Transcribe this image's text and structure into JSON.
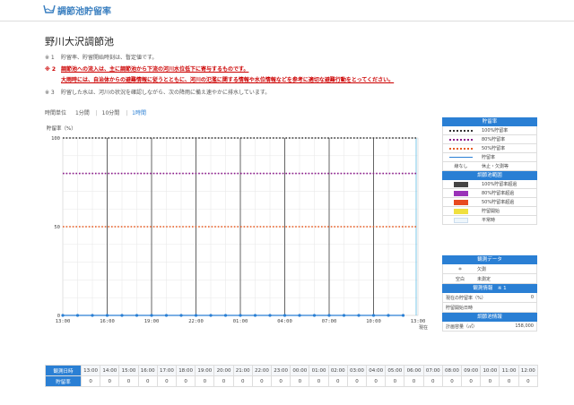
{
  "header": {
    "title": "調節池貯留率"
  },
  "site": {
    "name": "野川大沢調節池"
  },
  "notes": [
    {
      "marker": "※ 1",
      "text": "貯留率、貯留開始時刻は、暫定値です。"
    },
    {
      "marker": "※ 2",
      "line1": "調節池への流入は、主に調節池から下流の河川水位低下に寄与するものです。",
      "line2": "大雨時には、自治体からの避難情報に従うとともに、河川の氾濫に関する情報や水位情報などを参考に適切な避難行動をとってください。"
    },
    {
      "marker": "※ 3",
      "text": "貯留した水は、河川の状況を確認しながら、次の降雨に備え速やかに排水しています。"
    }
  ],
  "time_unit": {
    "label": "時間単位",
    "options": [
      "1分間",
      "10分間",
      "1時間"
    ],
    "active": "1時間"
  },
  "chart_data": {
    "type": "line",
    "ylabel": "貯留率（%）",
    "ylim": [
      0,
      100
    ],
    "yticks": [
      "0",
      "50",
      "100"
    ],
    "x_ticks": [
      "13:00",
      "16:00",
      "19:00",
      "22:00",
      "01:00",
      "04:00",
      "07:00",
      "10:00",
      "13:00"
    ],
    "now_label": "現在",
    "reference_lines": [
      {
        "level": 100,
        "color": "#333333"
      },
      {
        "level": 80,
        "color": "#8b1a8b"
      },
      {
        "level": 50,
        "color": "#e85a20"
      }
    ],
    "series": [
      {
        "x": [
          "13:00",
          "14:00",
          "15:00",
          "16:00",
          "17:00",
          "18:00",
          "19:00",
          "20:00",
          "21:00",
          "22:00",
          "23:00",
          "00:00",
          "01:00",
          "02:00",
          "03:00",
          "04:00",
          "05:00",
          "06:00",
          "07:00",
          "08:00",
          "09:00",
          "10:00",
          "11:00",
          "12:00"
        ],
        "values": [
          0,
          0,
          0,
          0,
          0,
          0,
          0,
          0,
          0,
          0,
          0,
          0,
          0,
          0,
          0,
          0,
          0,
          0,
          0,
          0,
          0,
          0,
          0,
          0
        ],
        "color": "#2a7fd4"
      }
    ]
  },
  "legend": {
    "title": "貯留率",
    "items": [
      {
        "label": "100%貯留率",
        "color": "#333333",
        "kind": "dot"
      },
      {
        "label": "80%貯留率",
        "color": "#8b1a8b",
        "kind": "dot"
      },
      {
        "label": "50%貯留率",
        "color": "#e85a20",
        "kind": "dot"
      },
      {
        "label": "貯留率",
        "color": "#2a7fd4",
        "kind": "solid"
      },
      {
        "sym": "線なし",
        "label": "休止・欠測等",
        "kind": "text"
      }
    ],
    "bg_title": "調節池範囲",
    "bg_items": [
      {
        "label": "100%貯留率超過",
        "color": "#444444"
      },
      {
        "label": "80%貯留率超過",
        "color": "#9a32b8"
      },
      {
        "label": "50%貯留率超過",
        "color": "#e84a20"
      },
      {
        "label": "貯留開始",
        "color": "#f0e040"
      },
      {
        "label": "平常時",
        "color": "#eef6fb"
      }
    ]
  },
  "data_legend": {
    "title": "観測データ",
    "items": [
      {
        "sym": "＊",
        "label": "欠測"
      },
      {
        "sym": "空白",
        "label": "未測定"
      }
    ],
    "info_title": "観測情報　※ 1",
    "info": [
      {
        "label": "現在の貯留率（%）",
        "value": "0"
      },
      {
        "label": "貯留開始日時",
        "value": ""
      }
    ],
    "facility_title": "調節池情報",
    "facility": [
      {
        "label": "計画容量（㎥）",
        "value": "158,000"
      }
    ]
  },
  "table": {
    "row_labels": [
      "観測日時",
      "貯留率"
    ],
    "times": [
      "13:00",
      "14:00",
      "15:00",
      "16:00",
      "17:00",
      "18:00",
      "19:00",
      "20:00",
      "21:00",
      "22:00",
      "23:00",
      "00:00",
      "01:00",
      "02:00",
      "03:00",
      "04:00",
      "05:00",
      "06:00",
      "07:00",
      "08:00",
      "09:00",
      "10:00",
      "11:00",
      "12:00"
    ],
    "values": [
      "0",
      "0",
      "0",
      "0",
      "0",
      "0",
      "0",
      "0",
      "0",
      "0",
      "0",
      "0",
      "0",
      "0",
      "0",
      "0",
      "0",
      "0",
      "0",
      "0",
      "0",
      "0",
      "0",
      "0"
    ]
  }
}
